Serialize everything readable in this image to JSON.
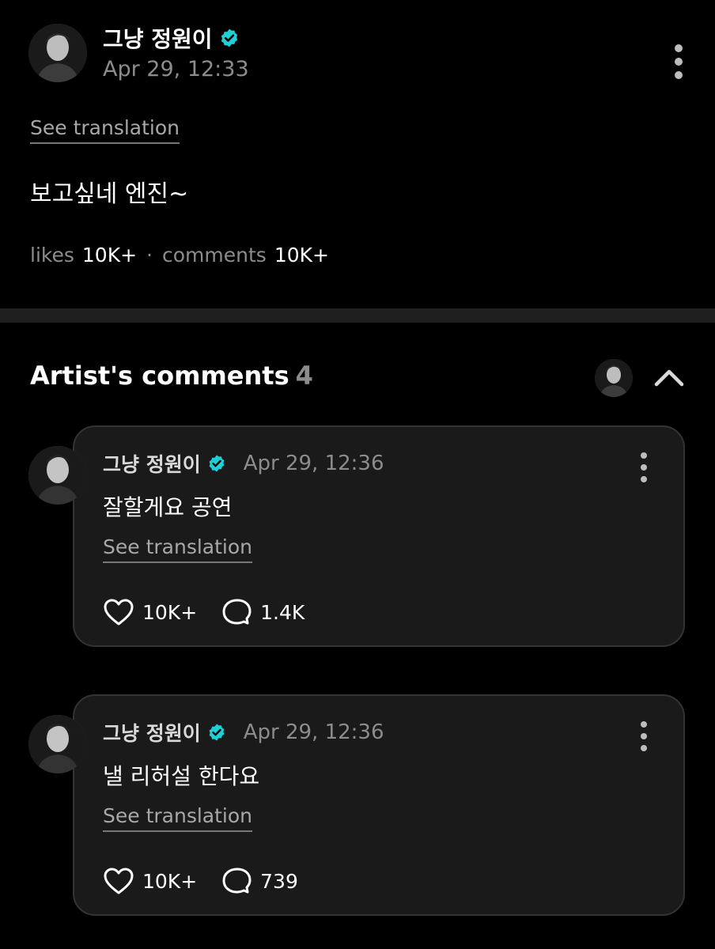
{
  "post": {
    "author": "그냥 정원이",
    "timestamp": "Apr 29, 12:33",
    "see_translation": "See translation",
    "body": "보고싶네 엔진~",
    "likes_label": "likes",
    "likes_count": "10K+",
    "separator": "·",
    "comments_label": "comments",
    "comments_count": "10K+"
  },
  "artist_comments": {
    "title": "Artist's comments",
    "count": "4",
    "items": [
      {
        "author": "그냥 정원이",
        "timestamp": "Apr 29, 12:36",
        "text": "잘할게요 공연",
        "see_translation": "See translation",
        "likes": "10K+",
        "replies": "1.4K"
      },
      {
        "author": "그냥 정원이",
        "timestamp": "Apr 29, 12:36",
        "text": "낼 리허설 한다요",
        "see_translation": "See translation",
        "likes": "10K+",
        "replies": "739"
      }
    ]
  },
  "icons": {
    "verified": "verified-badge-icon",
    "more": "more-vertical-icon",
    "collapse": "chevron-up-icon",
    "like": "heart-icon",
    "reply": "comment-bubble-icon"
  },
  "colors": {
    "background": "#000000",
    "card": "#1a1a1a",
    "verified_badge": "#1ecfd6",
    "muted_text": "#8c8c8c",
    "divider": "#1f1f1f"
  }
}
